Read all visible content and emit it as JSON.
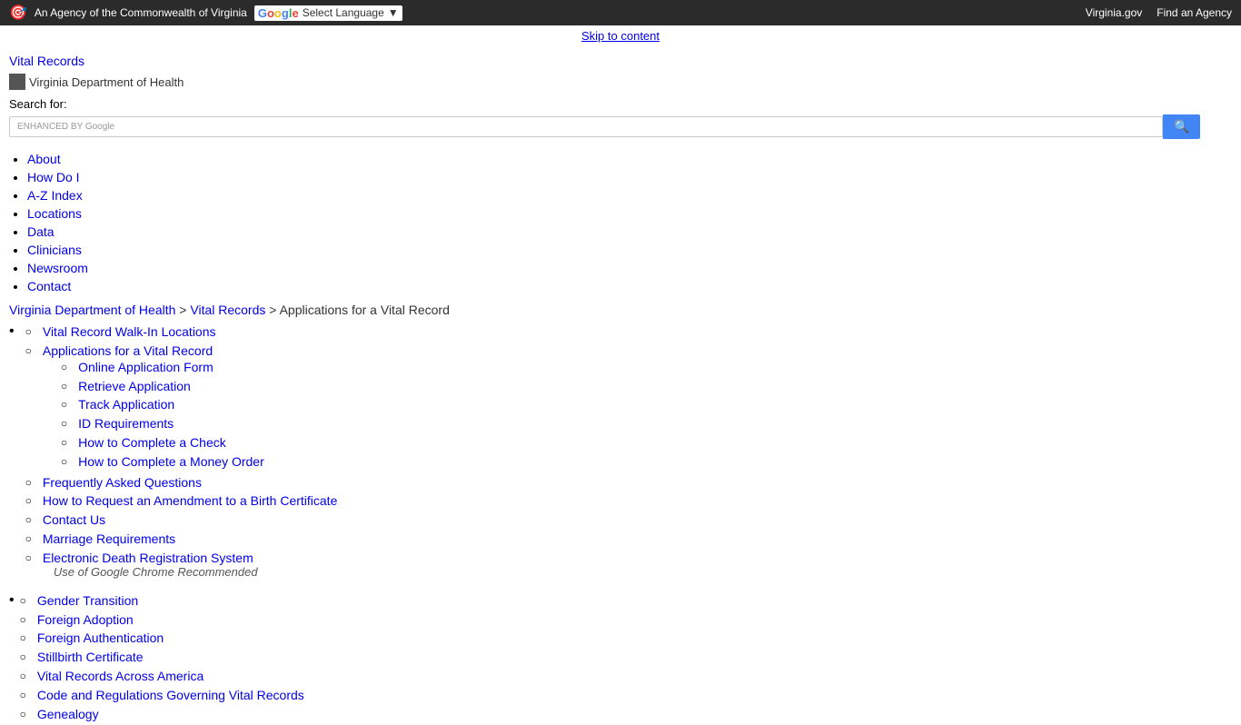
{
  "topbar": {
    "agency_text": "An Agency of the Commonwealth of Virginia",
    "translate_label": "Select Language",
    "links": [
      {
        "label": "Virginia.gov",
        "url": "#"
      },
      {
        "label": "Find an Agency",
        "url": "#"
      }
    ]
  },
  "skip_link": "Skip to content",
  "vital_records_title": "Vital Records",
  "logo": {
    "alt": "Virginia Department of Health"
  },
  "search": {
    "label": "Search for:",
    "placeholder": "",
    "enhanced_by": "ENHANCED BY Google",
    "button_icon": "🔍"
  },
  "main_nav": {
    "items": [
      {
        "label": "About",
        "url": "#"
      },
      {
        "label": "How Do I",
        "url": "#"
      },
      {
        "label": "A-Z Index",
        "url": "#"
      },
      {
        "label": "Locations",
        "url": "#"
      },
      {
        "label": "Data",
        "url": "#"
      },
      {
        "label": "Clinicians",
        "url": "#"
      },
      {
        "label": "Newsroom",
        "url": "#"
      },
      {
        "label": "Contact",
        "url": "#"
      }
    ]
  },
  "breadcrumb": {
    "items": [
      {
        "label": "Virginia Department of Health",
        "url": "#"
      },
      {
        "label": "Vital Records",
        "url": "#"
      },
      {
        "label": "Applications for a Vital Record",
        "url": null
      }
    ]
  },
  "content_nav": {
    "sections": [
      {
        "items": [
          {
            "label": "Vital Record Walk-In Locations",
            "url": "#",
            "children": []
          },
          {
            "label": "Applications for a Vital Record",
            "url": "#",
            "children": [
              {
                "label": "Online Application Form",
                "url": "#"
              },
              {
                "label": "Retrieve Application",
                "url": "#"
              },
              {
                "label": "Track Application",
                "url": "#"
              },
              {
                "label": "ID Requirements",
                "url": "#"
              },
              {
                "label": "How to Complete a Check",
                "url": "#"
              },
              {
                "label": "How to Complete a Money Order",
                "url": "#"
              }
            ]
          },
          {
            "label": "Frequently Asked Questions",
            "url": "#",
            "children": []
          },
          {
            "label": "How to Request an Amendment to a Birth Certificate",
            "url": "#",
            "children": []
          },
          {
            "label": "Contact Us",
            "url": "#",
            "children": []
          },
          {
            "label": "Marriage Requirements",
            "url": "#",
            "children": []
          },
          {
            "label": "Electronic Death Registration System",
            "url": "#",
            "children": [],
            "note": "Use of Google Chrome Recommended"
          }
        ]
      },
      {
        "items": [
          {
            "label": "Gender Transition",
            "url": "#",
            "children": []
          },
          {
            "label": "Foreign Adoption",
            "url": "#",
            "children": []
          },
          {
            "label": "Foreign Authentication",
            "url": "#",
            "children": []
          },
          {
            "label": "Stillbirth Certificate",
            "url": "#",
            "children": []
          },
          {
            "label": "Vital Records Across America",
            "url": "#",
            "children": []
          },
          {
            "label": "Code and Regulations Governing Vital Records",
            "url": "#",
            "children": []
          },
          {
            "label": "Genealogy",
            "url": "#",
            "children": []
          }
        ]
      }
    ]
  }
}
